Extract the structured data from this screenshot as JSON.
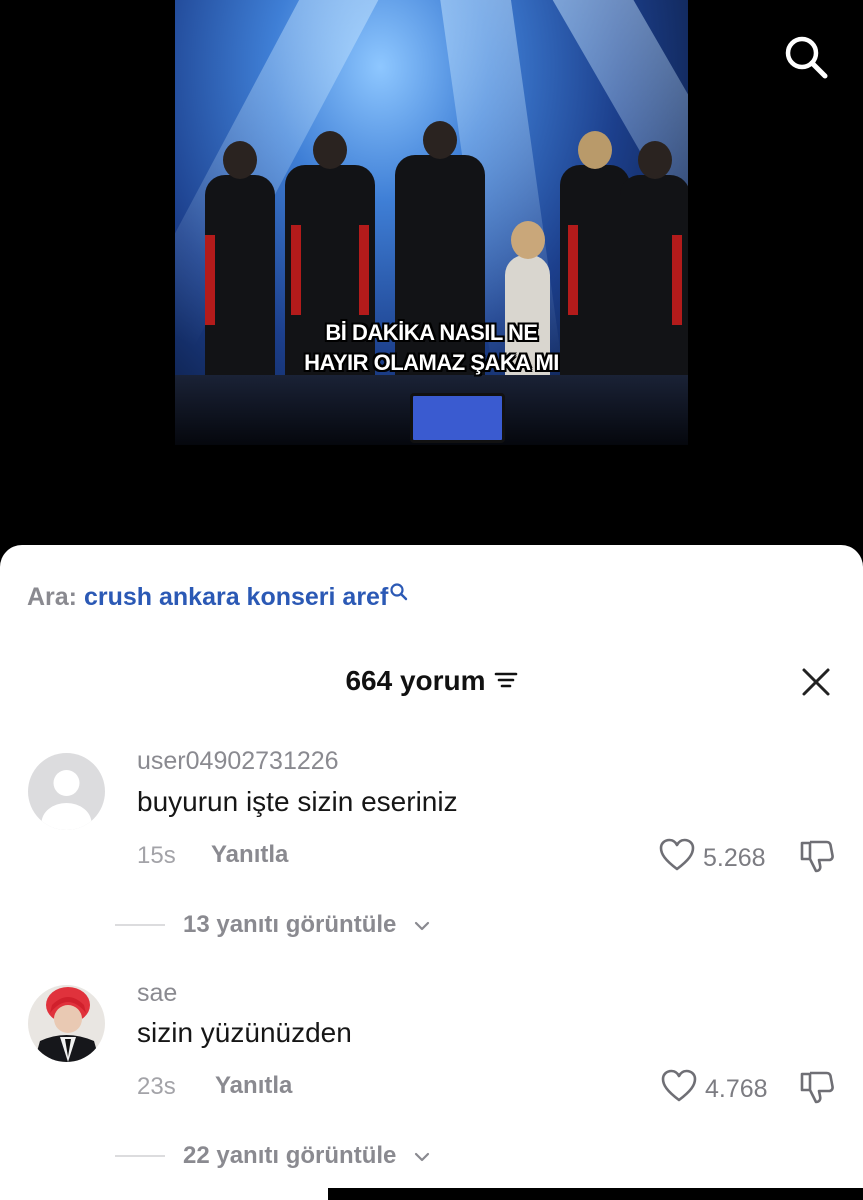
{
  "video": {
    "caption_line1": "Bİ DAKİKA NASIL NE",
    "caption_line2": "HAYIR OLAMAZ ŞAKA MI"
  },
  "search": {
    "prefix": "Ara:",
    "query": "crush ankara konseri aref"
  },
  "comments_panel": {
    "count_label": "664 yorum"
  },
  "comments": [
    {
      "username": "user04902731226",
      "text": "buyurun işte sizin eseriniz",
      "time": "15s",
      "reply_label": "Yanıtla",
      "likes": "5.268",
      "view_replies": "13 yanıtı görüntüle"
    },
    {
      "username": "sae",
      "text": "sizin yüzünüzden",
      "time": "23s",
      "reply_label": "Yanıtla",
      "likes": "4.768",
      "view_replies": "22 yanıtı görüntüle"
    }
  ],
  "colors": {
    "accent_link": "#2b59b5",
    "muted_text": "#8a8a90"
  },
  "icons": [
    "search-icon",
    "sort-icon",
    "close-icon",
    "heart-icon",
    "dislike-icon",
    "chevron-down-icon"
  ]
}
